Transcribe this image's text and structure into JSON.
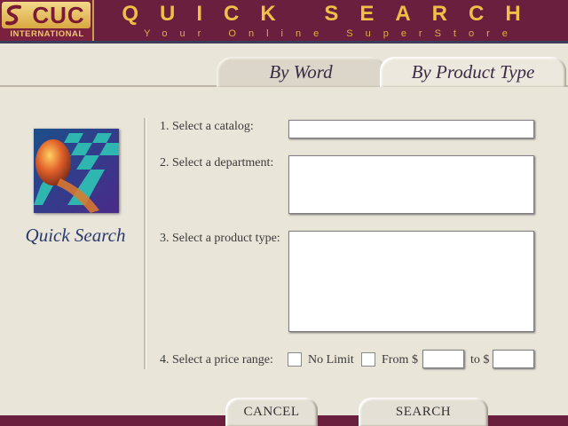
{
  "header": {
    "logo_text": "CUC",
    "logo_subtext": "INTERNATIONAL",
    "title": "QUICK SEARCH",
    "tagline": "Your Online SuperStore"
  },
  "tabs": [
    {
      "label": "By Word",
      "active": false
    },
    {
      "label": "By Product Type",
      "active": true
    }
  ],
  "sidebar": {
    "label": "Quick Search"
  },
  "form": {
    "catalog_label": "1. Select a catalog:",
    "department_label": "2. Select a department:",
    "product_type_label": "3. Select a product type:",
    "price_range_label": "4. Select a price range:",
    "no_limit_label": "No Limit",
    "from_label": "From",
    "currency_from": "$",
    "to_label": "to $",
    "catalog_value": "",
    "from_value": "",
    "to_value": ""
  },
  "buttons": {
    "cancel": "CANCEL",
    "search": "SEARCH"
  },
  "colors": {
    "header_bg": "#6b1f3e",
    "title_gold": "#f0c046",
    "page_bg": "#e9e5d9",
    "label_blue": "#2b3a6d"
  }
}
